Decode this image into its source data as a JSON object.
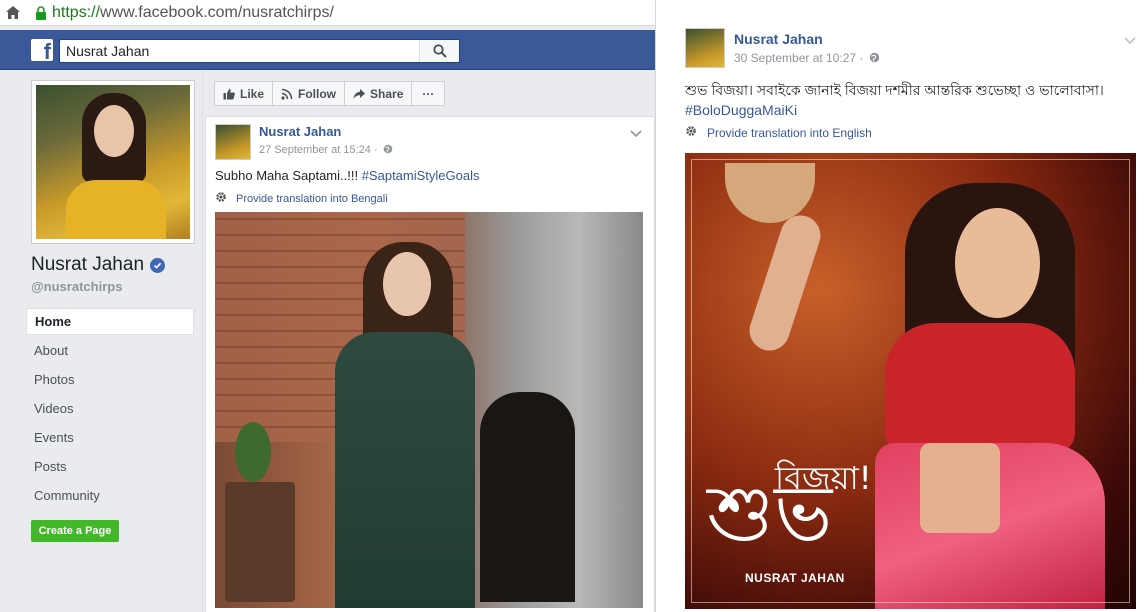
{
  "browser": {
    "url_scheme": "https://",
    "url_rest": "www.facebook.com/nusratchirps/"
  },
  "left_page": {
    "logo": "f",
    "search": {
      "value": "Nusrat Jahan"
    },
    "profile": {
      "name": "Nusrat Jahan",
      "handle": "@nusratchirps"
    },
    "nav": [
      {
        "label": "Home",
        "active": true
      },
      {
        "label": "About"
      },
      {
        "label": "Photos"
      },
      {
        "label": "Videos"
      },
      {
        "label": "Events"
      },
      {
        "label": "Posts"
      },
      {
        "label": "Community"
      }
    ],
    "create_page_label": "Create a Page",
    "actions": {
      "like": "Like",
      "follow": "Follow",
      "share": "Share",
      "more": "···"
    },
    "post": {
      "author": "Nusrat Jahan",
      "time": "27 September at 15:24 ·",
      "text": "Subho Maha Saptami..!!! ",
      "hashtag": "#SaptamiStyleGoals",
      "translate": "Provide translation into Bengali"
    }
  },
  "right_post": {
    "author": "Nusrat Jahan",
    "time": "30 September at 10:27 ·",
    "text": "শুভ বিজয়া। সবাইকে জানাই বিজয়া দশমীর আন্তরিক শুভেচ্ছা ও ভালোবাসা।",
    "hashtag": "#BoloDuggaMaiKi",
    "translate": "Provide translation into English",
    "image_text": {
      "line1": "বিজয়া!",
      "line2": "শুভ",
      "name": "NUSRAT JAHAN"
    }
  },
  "colors": {
    "facebook_blue": "#3b5998",
    "link_blue": "#365899",
    "create_green": "#42b72a",
    "secure_green": "#1a7a1a"
  },
  "icons": [
    "home-icon",
    "lock-icon",
    "facebook-logo",
    "search-icon",
    "verified-icon",
    "like-icon",
    "follow-icon",
    "share-icon",
    "more-icon",
    "chevron-down-icon",
    "gear-icon",
    "globe-icon"
  ]
}
